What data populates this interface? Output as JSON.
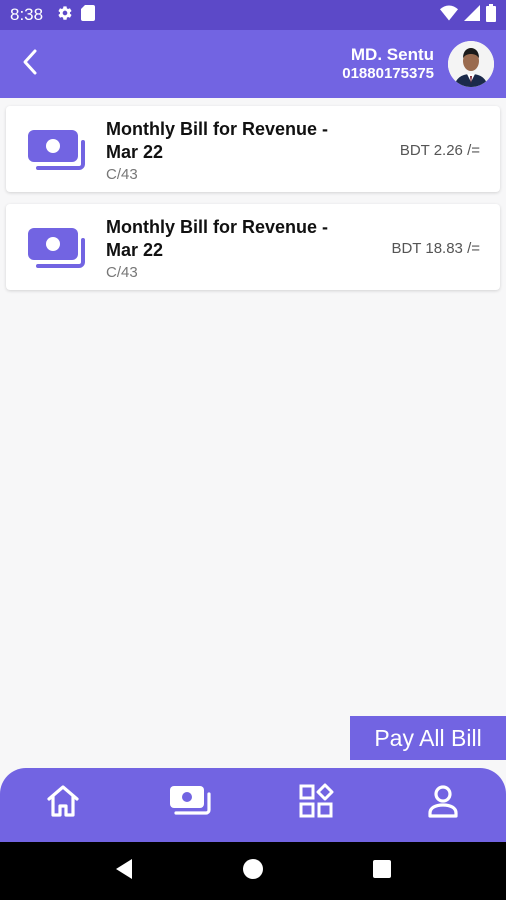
{
  "status_bar": {
    "time": "8:38",
    "icons": [
      "settings-icon",
      "sd-card-icon",
      "wifi-icon",
      "signal-icon",
      "battery-icon"
    ]
  },
  "header": {
    "back_icon": "back-arrow-icon",
    "user_name": "MD. Sentu",
    "user_phone": "01880175375"
  },
  "bills": [
    {
      "icon": "money-icon",
      "title": "Monthly Bill for Revenue - Mar 22",
      "code": "C/43",
      "amount": "BDT 2.26 /="
    },
    {
      "icon": "money-icon",
      "title": "Monthly Bill for Revenue - Mar 22",
      "code": "C/43",
      "amount": "BDT 18.83 /="
    }
  ],
  "pay_all_label": "Pay All Bill",
  "bottom_nav": [
    "home-icon",
    "money-icon",
    "category-icon",
    "profile-icon"
  ],
  "system_nav": [
    "back-triangle-icon",
    "home-circle-icon",
    "recents-square-icon"
  ],
  "colors": {
    "primary": "#7264e2",
    "status_bar": "#5c49c8",
    "background": "#f7f7f8"
  }
}
